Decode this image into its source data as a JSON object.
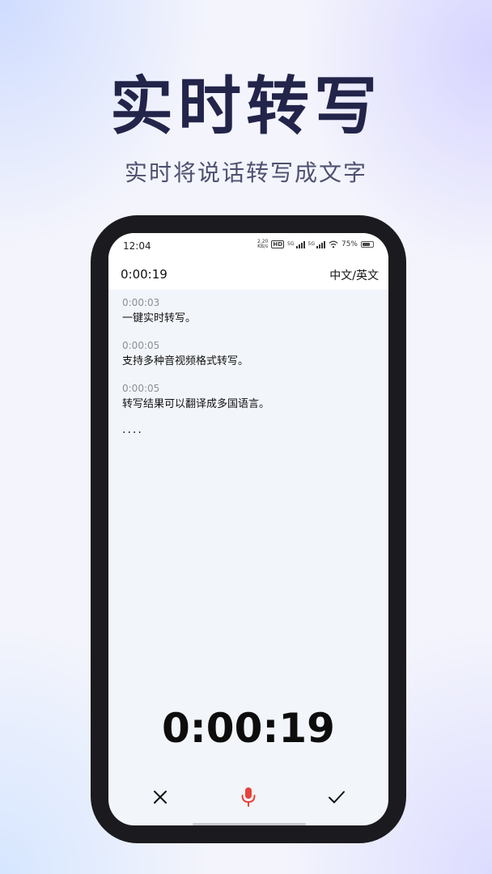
{
  "hero": {
    "title": "实时转写",
    "subtitle": "实时将说话转写成文字"
  },
  "status_bar": {
    "time": "12:04",
    "net_speed_value": "2.20",
    "net_speed_unit": "KB/s",
    "hd_badge": "HD",
    "signal_1": "5G",
    "signal_2": "5G",
    "battery": "75%",
    "battery_level": 0.75
  },
  "header": {
    "timer": "0:00:19",
    "language_toggle": "中文/英文"
  },
  "transcript": [
    {
      "time": "0:00:03",
      "text": "一键实时转写。"
    },
    {
      "time": "0:00:05",
      "text": "支持多种音视频格式转写。"
    },
    {
      "time": "0:00:05",
      "text": "转写结果可以翻译成多国语言。"
    }
  ],
  "transcript_more": "....",
  "big_timer": "0:00:19",
  "controls": {
    "cancel_icon": "close-icon",
    "mic_icon": "microphone-icon",
    "confirm_icon": "checkmark-icon"
  },
  "colors": {
    "title": "#23244a",
    "mic_accent": "#e5433b",
    "frame": "#1b1b1f",
    "screen_bg": "#f2f5fa"
  }
}
